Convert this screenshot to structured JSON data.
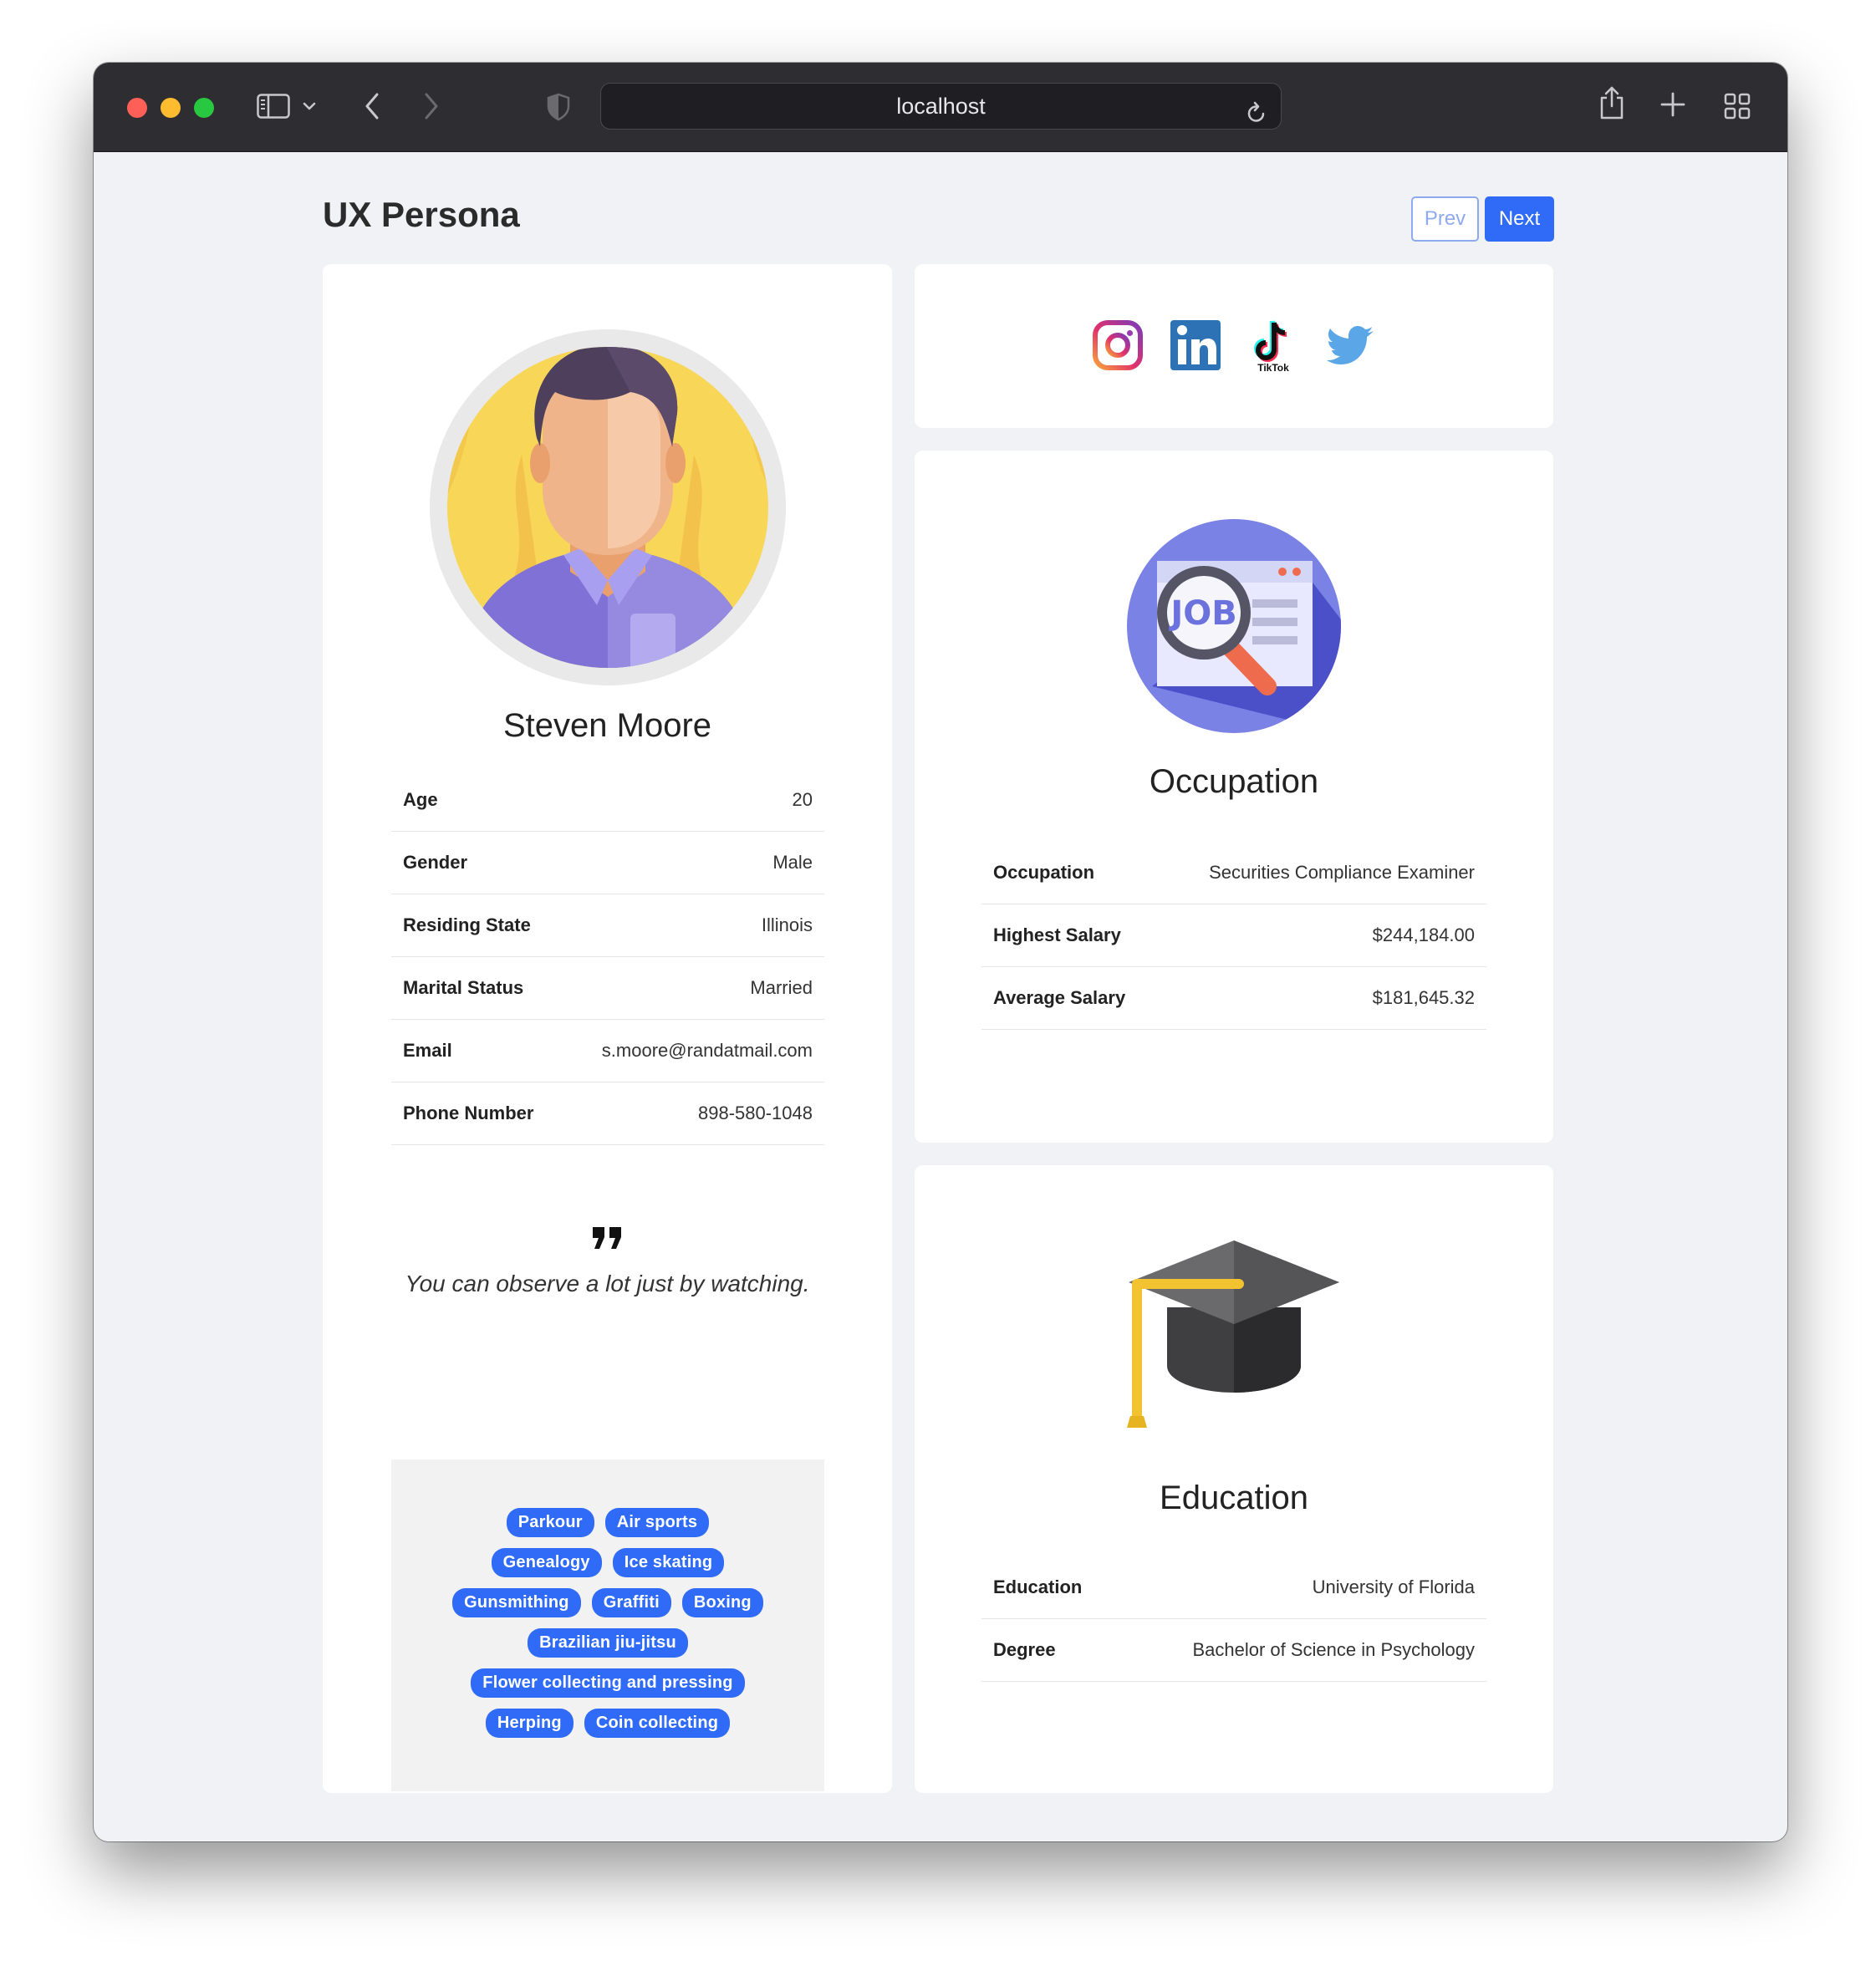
{
  "browser": {
    "url": "localhost"
  },
  "page": {
    "title": "UX Persona",
    "prev_label": "Prev",
    "next_label": "Next"
  },
  "persona": {
    "name": "Steven Moore",
    "details": [
      {
        "label": "Age",
        "value": "20"
      },
      {
        "label": "Gender",
        "value": "Male"
      },
      {
        "label": "Residing State",
        "value": "Illinois"
      },
      {
        "label": "Marital Status",
        "value": "Married"
      },
      {
        "label": "Email",
        "value": "s.moore@randatmail.com"
      },
      {
        "label": "Phone Number",
        "value": "898-580-1048"
      }
    ],
    "quote": "You can observe a lot just by watching.",
    "interests": [
      [
        "Parkour",
        "Air sports"
      ],
      [
        "Genealogy",
        "Ice skating"
      ],
      [
        "Gunsmithing",
        "Graffiti",
        "Boxing"
      ],
      [
        "Brazilian jiu-jitsu"
      ],
      [
        "Flower collecting and pressing"
      ],
      [
        "Herping",
        "Coin collecting"
      ]
    ]
  },
  "social": {
    "icons": [
      "instagram-icon",
      "linkedin-icon",
      "tiktok-icon",
      "twitter-icon"
    ],
    "tiktok_caption": "TikTok"
  },
  "occupation": {
    "title": "Occupation",
    "illustration_text": "JOB",
    "rows": [
      {
        "label": "Occupation",
        "value": "Securities Compliance Examiner"
      },
      {
        "label": "Highest Salary",
        "value": "$244,184.00"
      },
      {
        "label": "Average Salary",
        "value": "$181,645.32"
      }
    ]
  },
  "education": {
    "title": "Education",
    "rows": [
      {
        "label": "Education",
        "value": "University of Florida"
      },
      {
        "label": "Degree",
        "value": "Bachelor of Science in Psychology"
      }
    ]
  },
  "colors": {
    "accent": "#2f6bf6",
    "page_bg": "#f0f2f5",
    "titlebar": "#2e2d31"
  }
}
